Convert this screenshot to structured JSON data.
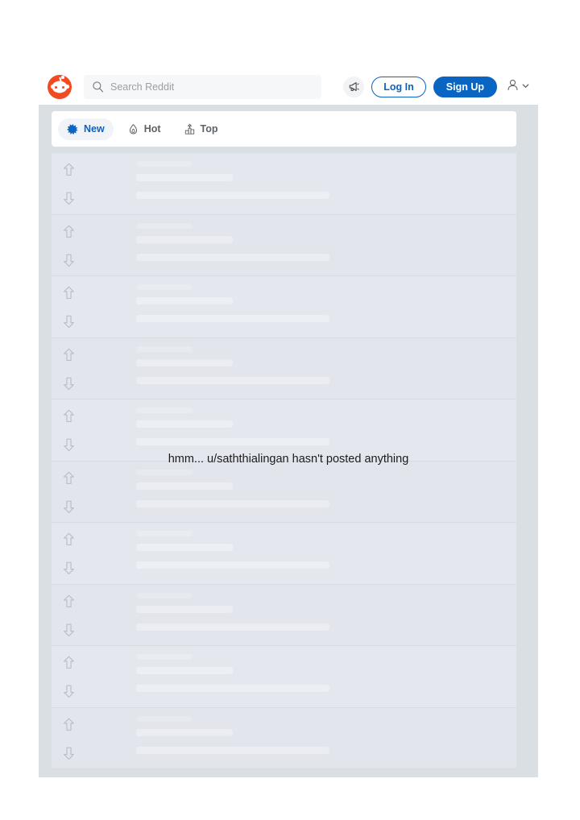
{
  "app": {
    "name": "Reddit",
    "brand_color": "#f04b23",
    "accent_color": "#0a64c2"
  },
  "header": {
    "logo_icon": "reddit-snoo-logo",
    "search": {
      "icon": "search-icon",
      "placeholder": "Search Reddit",
      "value": ""
    },
    "megaphone_icon": "megaphone-icon",
    "login_label": "Log In",
    "signup_label": "Sign Up",
    "avatar_icon": "user-avatar-icon",
    "avatar_chevron_icon": "chevron-down-icon"
  },
  "tabs": [
    {
      "label": "New",
      "icon": "sparkle-icon",
      "active": true
    },
    {
      "label": "Hot",
      "icon": "flame-icon",
      "active": false
    },
    {
      "label": "Top",
      "icon": "podium-chart-icon",
      "active": false
    }
  ],
  "main": {
    "empty_message": "hmm... u/saththialingan hasn't posted anything",
    "username": "u/saththialingan",
    "skeleton_row_count": 10,
    "vote_up_icon": "upvote-arrow-icon",
    "vote_down_icon": "downvote-arrow-icon"
  }
}
